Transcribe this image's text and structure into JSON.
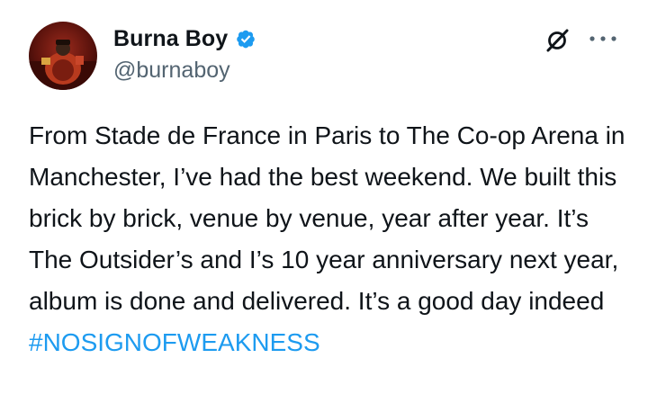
{
  "author": {
    "display_name": "Burna Boy",
    "handle": "@burnaboy",
    "verified": true,
    "avatar_icon": "user-avatar"
  },
  "icons": {
    "verified": "verified-badge-icon",
    "grok": "grok-icon",
    "more": "more-dots-icon"
  },
  "tweet": {
    "text": "From Stade de France in Paris to The Co-op Arena in Manchester, I’ve had the best weekend. We built this brick by brick, venue by venue, year after year. It’s The Outsider’s and I’s 10 year anniversary next year, album is done and delivered. It’s a good day indeed",
    "hashtag": "#NOSIGNOFWEAKNESS"
  },
  "colors": {
    "accent": "#1d9bf0",
    "text_primary": "#0f1419",
    "text_secondary": "#536471"
  }
}
